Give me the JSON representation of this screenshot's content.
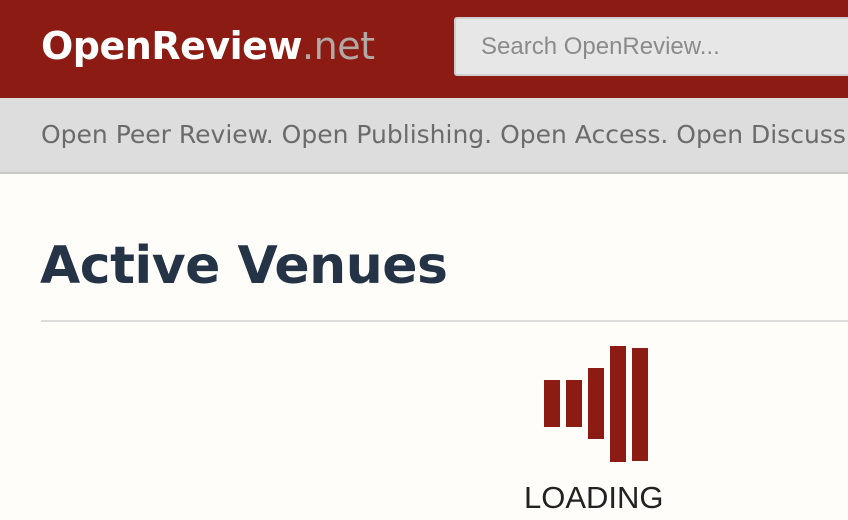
{
  "header": {
    "brand_name": "OpenReview",
    "brand_suffix": ".net",
    "search": {
      "placeholder": "Search OpenReview...",
      "value": ""
    }
  },
  "tagline": "Open Peer Review. Open Publishing. Open Access. Open Discussion.",
  "main": {
    "title": "Active Venues",
    "loading": {
      "label": "LOADING",
      "icon": "loading-bars-icon"
    }
  },
  "colors": {
    "brand": "#8c1b13",
    "title": "#243446",
    "tagline_bar": "#dddddd"
  }
}
